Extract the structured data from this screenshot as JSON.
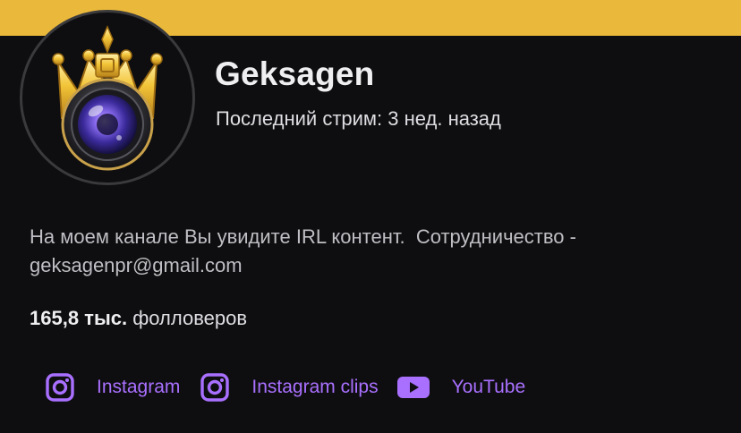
{
  "banner": {
    "color": "#eab83a"
  },
  "avatar": {
    "icon": "crowned-camera-lens-icon"
  },
  "channel": {
    "name": "Geksagen",
    "last_stream": "Последний стрим: 3 нед. назад"
  },
  "bio": {
    "line1": "На моем канале Вы увидите IRL контент.  Сотрудничество -",
    "line2": "geksagenpr@gmail.com"
  },
  "followers": {
    "count": "165,8 тыс.",
    "label": "фолловеров"
  },
  "social_links": [
    {
      "label": "Instagram",
      "icon": "instagram-icon"
    },
    {
      "label": "Instagram clips",
      "icon": "instagram-icon"
    },
    {
      "label": "YouTube",
      "icon": "youtube-icon"
    }
  ],
  "colors": {
    "background": "#0e0e10",
    "link": "#a970ff",
    "text_primary": "#efeff1",
    "text_secondary": "#bfbfc4"
  }
}
